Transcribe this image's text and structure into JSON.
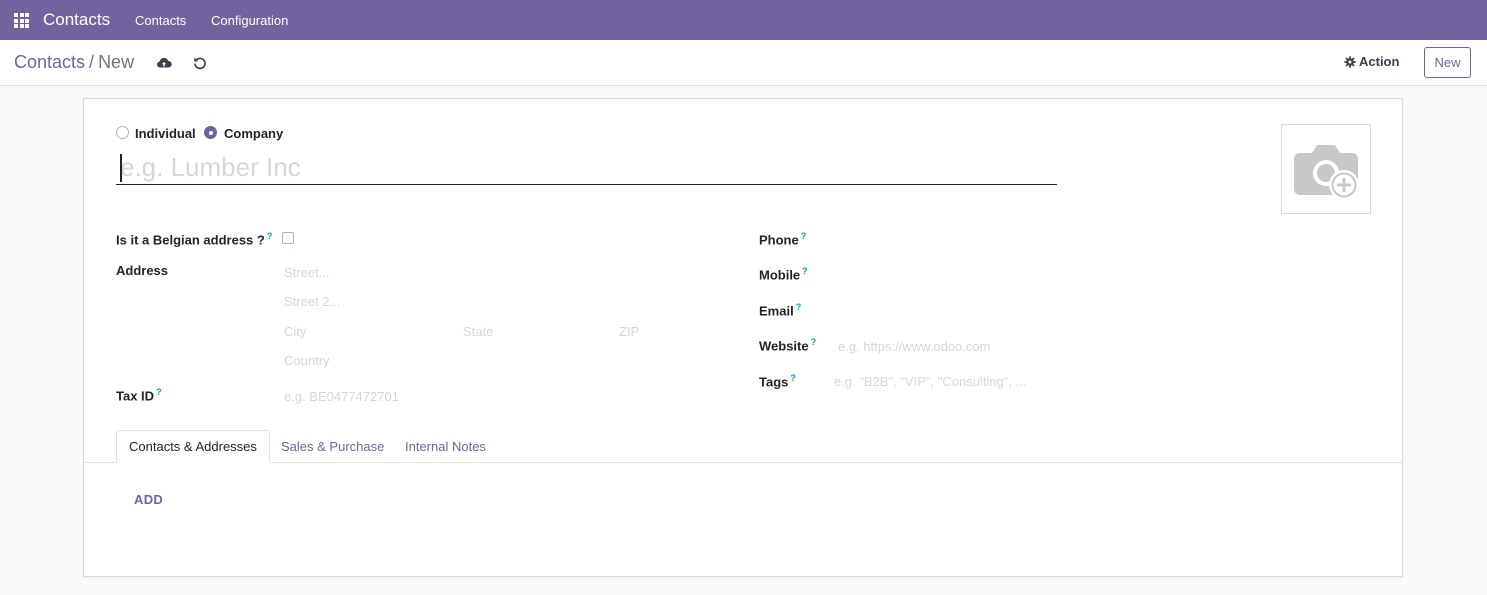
{
  "navbar": {
    "brand": "Contacts",
    "menu": [
      "Contacts",
      "Configuration"
    ]
  },
  "control_panel": {
    "breadcrumb_parent": "Contacts",
    "breadcrumb_separator": "/",
    "breadcrumb_current": "New",
    "action_label": "Action",
    "new_label": "New"
  },
  "form": {
    "company_type": {
      "options": [
        "Individual",
        "Company"
      ],
      "selected": "Company"
    },
    "name_placeholder": "e.g. Lumber Inc",
    "fields": {
      "belgian_address_label": "Is it a Belgian address ?",
      "address_label": "Address",
      "street_placeholder": "Street...",
      "street2_placeholder": "Street 2...",
      "city_placeholder": "City",
      "state_placeholder": "State",
      "zip_placeholder": "ZIP",
      "country_placeholder": "Country",
      "tax_id_label": "Tax ID",
      "tax_id_placeholder": "e.g. BE0477472701",
      "phone_label": "Phone",
      "mobile_label": "Mobile",
      "email_label": "Email",
      "website_label": "Website",
      "website_placeholder": "e.g. https://www.odoo.com",
      "tags_label": "Tags",
      "tags_placeholder": "e.g. \"B2B\", \"VIP\", \"Consulting\", ..."
    },
    "help_mark": "?",
    "tabs": [
      "Contacts & Addresses",
      "Sales & Purchase",
      "Internal Notes"
    ],
    "active_tab": "Contacts & Addresses",
    "add_label": "ADD"
  },
  "colors": {
    "brand": "#71639e",
    "help": "#00a0bd",
    "placeholder": "#d3d6da"
  },
  "icons": [
    "apps-grid-icon",
    "cloud-upload-icon",
    "undo-icon",
    "gear-icon",
    "camera-add-icon"
  ]
}
